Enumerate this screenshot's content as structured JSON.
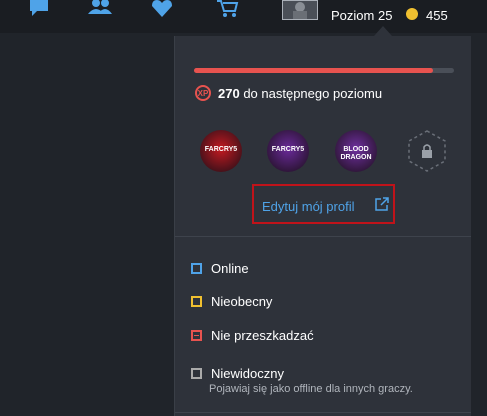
{
  "topbar": {
    "level_label": "Poziom 25",
    "coin_amount": "455",
    "nav_icons": [
      "chat-icon",
      "friends-icon",
      "wishlist-icon",
      "cart-icon"
    ]
  },
  "profile_menu": {
    "xp_progress": 0.92,
    "xp_badge": "XP",
    "xp_amount": "270",
    "xp_text": "do następnego poziomu",
    "games": [
      {
        "title": "FARCRY5",
        "color": "#c41a20"
      },
      {
        "title": "FARCRY5",
        "color": "#6a2a9a"
      },
      {
        "title": "BLOOD DRAGON",
        "color": "#7030a0"
      }
    ],
    "edit_profile_label": "Edytuj mój profil",
    "statuses": [
      {
        "label": "Online",
        "color": "#4fa3e8"
      },
      {
        "label": "Nieobecny",
        "color": "#f0c030"
      },
      {
        "label": "Nie przeszkadzać",
        "color": "#e8534f"
      },
      {
        "label": "Niewidoczny",
        "color": "#aaaaaa",
        "sub": "Pojawiaj się jako offline dla innych graczy."
      }
    ]
  },
  "colors": {
    "accent": "#4fa3e8",
    "xp": "#e8534f",
    "highlight_border": "#c0131a",
    "panel": "#2e323a",
    "background": "#20242a"
  }
}
